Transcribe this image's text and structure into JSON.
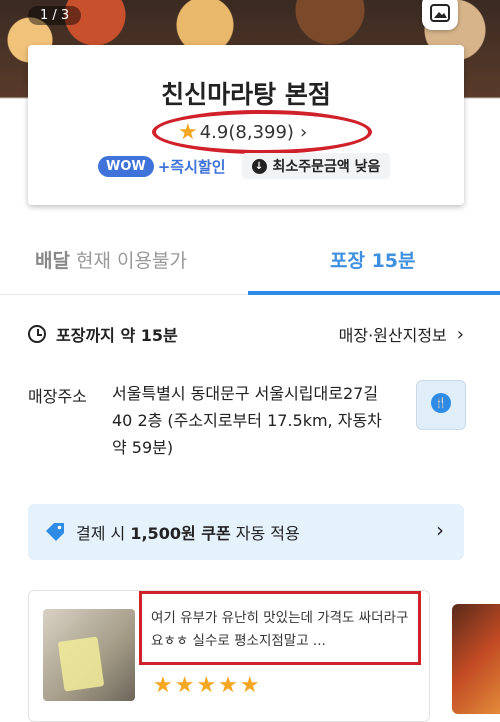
{
  "hero": {
    "counter": "1 / 3",
    "photo_button_icon": "photo-gallery-icon"
  },
  "store": {
    "name": "친신마라탕 본점",
    "rating": "4.9",
    "review_count": "(8,399)",
    "badges": {
      "wow_label": "WOW",
      "wow_text": "+즉시할인",
      "min_order": "최소주문금액 낮음"
    }
  },
  "tabs": {
    "delivery_label": "배달",
    "delivery_status": "현재 이용불가",
    "pickup_label": "포장 15분"
  },
  "info": {
    "pickup_time": "포장까지 약 15분",
    "store_info_link": "매장·원산지정보",
    "address_label": "매장주소",
    "address": "서울특별시 동대문구 서울시립대로27길 40 2층 (주소지로부터 17.5km, 자동차 약 59분)"
  },
  "coupon": {
    "prefix": "결제 시 ",
    "amount": "1,500원 쿠폰",
    "suffix": " 자동 적용"
  },
  "review": {
    "text": "여기 유부가 유난히 맛있는데 가격도 싸더라구요ㅎㅎ 실수로 평소지점말고 ...",
    "stars": "★★★★★",
    "rating": 5
  },
  "colors": {
    "accent": "#2f8ce6",
    "wow": "#3f73d9",
    "highlight": "#d0202a",
    "star": "#f5a623"
  }
}
